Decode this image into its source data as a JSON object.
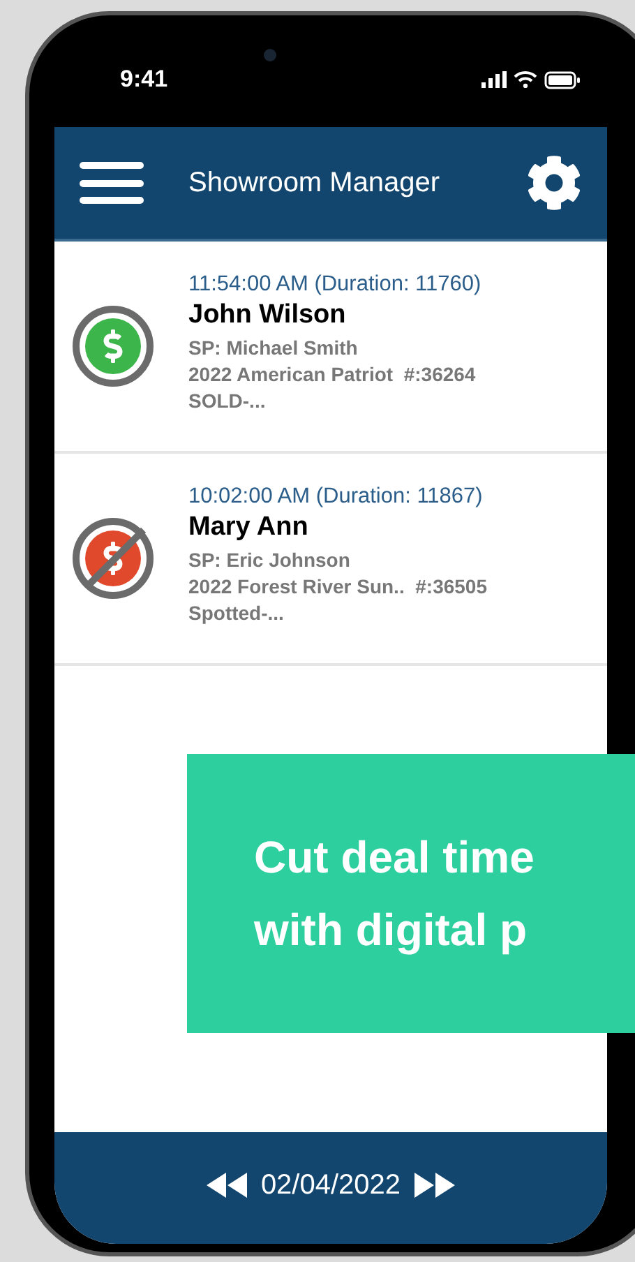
{
  "status_bar": {
    "time": "9:41"
  },
  "header": {
    "title": "Showroom Manager"
  },
  "deals": [
    {
      "kind": "sold",
      "time": "11:54:00 AM (Duration: 11760)",
      "customer": "John Wilson",
      "salesperson": "SP: Michael Smith",
      "unit": "2022 American Patriot  #:36264",
      "status": "SOLD-..."
    },
    {
      "kind": "lost",
      "time": "10:02:00 AM (Duration: 11867)",
      "customer": "Mary Ann",
      "salesperson": "SP: Eric Johnson",
      "unit": "2022 Forest River Sun..  #:36505",
      "status": "Spotted-..."
    }
  ],
  "footer": {
    "date": "02/04/2022"
  },
  "banner": {
    "lines": [
      "Cut deal time",
      "with digital p"
    ]
  }
}
